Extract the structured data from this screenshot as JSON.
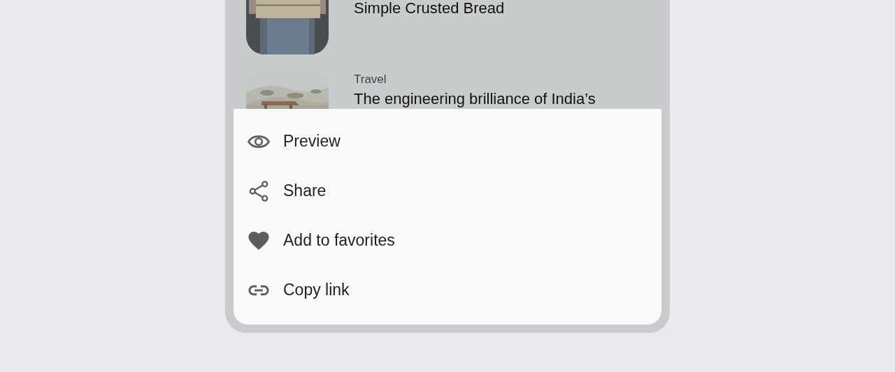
{
  "articles": [
    {
      "title": "Simple Crusted Bread",
      "kind": "picture"
    },
    {
      "category": "Travel",
      "title": "The engineering brilliance of India’s",
      "kind": "picture"
    }
  ],
  "menu": [
    {
      "kind": "preview",
      "label": "Preview"
    },
    {
      "kind": "share",
      "label": "Share"
    },
    {
      "kind": "favorite",
      "label": "Add to favorites"
    },
    {
      "kind": "link",
      "label": "Copy link"
    }
  ]
}
